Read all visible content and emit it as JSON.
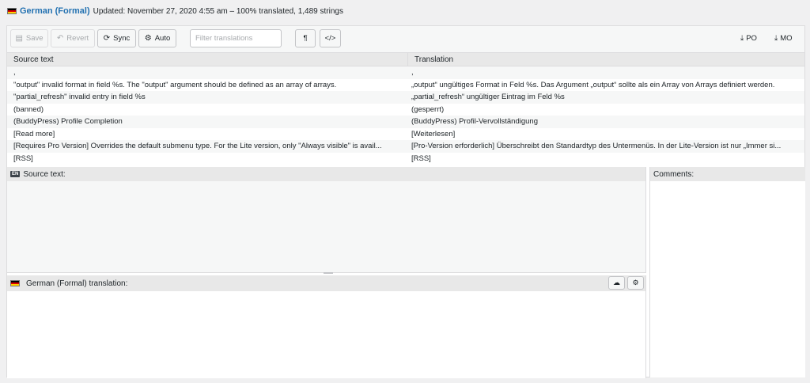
{
  "header": {
    "language": "German (Formal)",
    "meta": "Updated: November 27, 2020 4:55 am – 100% translated, 1,489 strings"
  },
  "toolbar": {
    "save": "Save",
    "revert": "Revert",
    "sync": "Sync",
    "auto": "Auto",
    "filter_placeholder": "Filter translations",
    "pilcrow": "¶",
    "code": "</>",
    "po": "PO",
    "mo": "MO"
  },
  "grid": {
    "source_header": "Source text",
    "translation_header": "Translation",
    "rows": [
      {
        "source": ",",
        "translation": ","
      },
      {
        "source": "\"output\" invalid format in field %s. The \"output\" argument should be defined as an array of arrays.",
        "translation": "„output“ ungültiges Format in Feld %s. Das Argument „output“ sollte als ein Array von Arrays definiert werden."
      },
      {
        "source": "\"partial_refresh\" invalid entry in field %s",
        "translation": "„partial_refresh“ ungültiger Eintrag im Feld %s"
      },
      {
        "source": "(banned)",
        "translation": "(gesperrt)"
      },
      {
        "source": "(BuddyPress) Profile Completion",
        "translation": "(BuddyPress) Profil-Vervollständigung"
      },
      {
        "source": "[Read more]",
        "translation": "[Weiterlesen]"
      },
      {
        "source": "[Requires Pro Version] Overrides the default submenu type. For the Lite version, only \"Always visible\" is avail...",
        "translation": "[Pro-Version erforderlich] Überschreibt den Standardtyp des Untermenüs. In der Lite-Version ist nur „Immer si..."
      },
      {
        "source": "[RSS]",
        "translation": "[RSS]"
      }
    ]
  },
  "source_pane": {
    "badge": "EN",
    "label": "Source text:"
  },
  "translation_pane": {
    "label": "German (Formal) translation:"
  },
  "comments_pane": {
    "label": "Comments:"
  },
  "icons": {
    "flag": "german-flag-icon",
    "save": "save-icon",
    "revert": "undo-icon",
    "sync": "sync-icon",
    "auto": "robot-icon",
    "download": "download-icon",
    "cloud": "cloud-icon"
  }
}
